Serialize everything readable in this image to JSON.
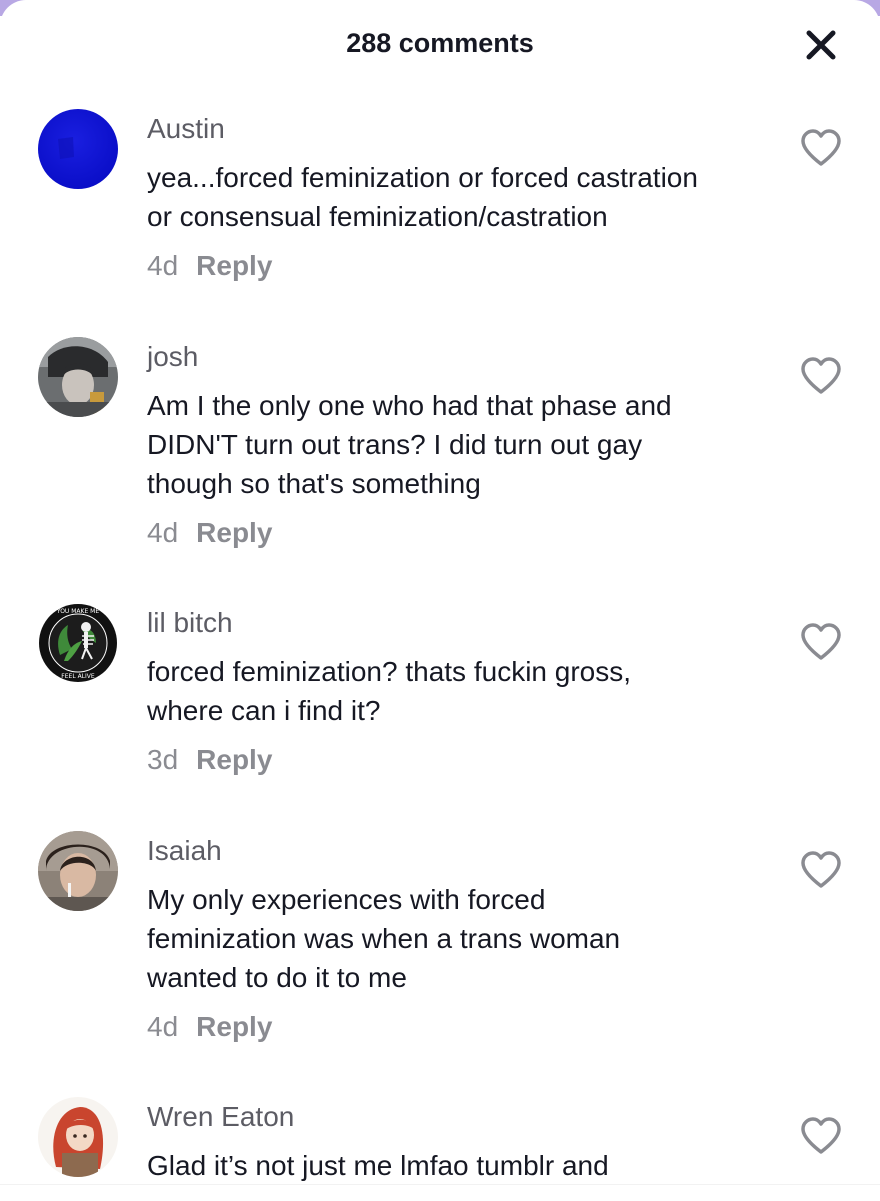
{
  "header": {
    "title": "288 comments",
    "close_icon": "close-icon"
  },
  "colors": {
    "username": "#5c5c64",
    "comment_text": "#161823",
    "meta_text": "#8a8b91",
    "sheet_accent": "#b8a8e4"
  },
  "comments": [
    {
      "username": "Austin",
      "lines": [
        "yea...forced feminization or forced castration",
        "or consensual feminization/castration"
      ],
      "time": "4d",
      "reply_label": "Reply",
      "avatar_icon": "blue-circle-avatar"
    },
    {
      "username": "josh",
      "lines": [
        "Am I the only one who had that phase and",
        "DIDN'T turn out trans? I did turn out gay",
        "though so that's something"
      ],
      "time": "4d",
      "reply_label": "Reply",
      "avatar_icon": "photo-avatar"
    },
    {
      "username": "lil bitch",
      "lines": [
        "forced feminization? thats fuckin gross,",
        "where can i find it?"
      ],
      "time": "3d",
      "reply_label": "Reply",
      "avatar_icon": "skeleton-plant-badge-avatar",
      "avatar_text_top": "YOU MAKE ME",
      "avatar_text_bottom": "FEEL ALIVE"
    },
    {
      "username": "Isaiah",
      "lines": [
        "My only experiences with forced",
        "feminization was when a trans woman",
        "wanted to do it to me"
      ],
      "time": "4d",
      "reply_label": "Reply",
      "avatar_icon": "photo-avatar"
    },
    {
      "username": "Wren Eaton",
      "lines": [
        "Glad it’s not just me lmfao tumblr and"
      ],
      "avatar_icon": "anime-girl-avatar"
    }
  ],
  "like_icon": "heart-outline-icon"
}
